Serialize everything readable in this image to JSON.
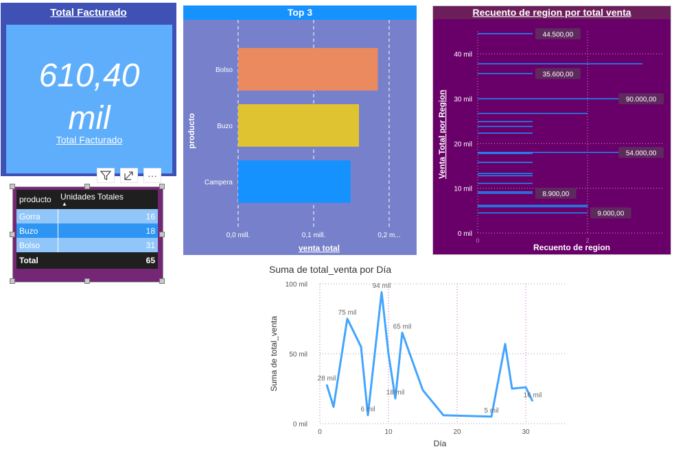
{
  "kpi": {
    "title": "Total Facturado",
    "value_line1": "610,40",
    "value_line2": "mil",
    "subtitle": "Total Facturado"
  },
  "visual_header": {
    "icons": [
      "filter-icon",
      "focus-mode-icon",
      "more-options-icon"
    ],
    "more_glyph": "···"
  },
  "table": {
    "columns": [
      "producto",
      "Unidades Totales"
    ],
    "sort_indicator": "▲",
    "rows": [
      {
        "producto": "Gorra",
        "unidades": "16"
      },
      {
        "producto": "Buzo",
        "unidades": "18"
      },
      {
        "producto": "Bolso",
        "unidades": "31"
      }
    ],
    "total_label": "Total",
    "total_value": "65"
  },
  "chart_data": [
    {
      "type": "bar",
      "orientation": "horizontal",
      "title": "Top 3",
      "xlabel": "venta total",
      "ylabel": "producto",
      "categories": [
        "Bolso",
        "Buzo",
        "Campera"
      ],
      "values": [
        185000,
        160000,
        149000
      ],
      "colors": [
        "#eb895f",
        "#e0c331",
        "#1692ff"
      ],
      "xlim": [
        0,
        200000
      ],
      "x_ticks": [
        0,
        100000,
        200000
      ],
      "x_tick_labels": [
        "0,0 mill.",
        "0,1 mill.",
        "0,2 m..."
      ],
      "grid": "dashed-vertical"
    },
    {
      "type": "bar",
      "orientation": "horizontal",
      "title": "Recuento de region por total venta",
      "xlabel": "Recuento de region",
      "ylabel": "Venta Total por Region",
      "xlim": [
        0,
        3
      ],
      "x_ticks": [
        0,
        2
      ],
      "ylim": [
        0,
        45000
      ],
      "y_ticks": [
        0,
        10000,
        20000,
        30000,
        40000
      ],
      "y_tick_labels": [
        "0 mil",
        "10 mil",
        "20 mil",
        "30 mil",
        "40 mil"
      ],
      "points": [
        {
          "y": 44500,
          "x": 1
        },
        {
          "y": 37800,
          "x": 3
        },
        {
          "y": 35600,
          "x": 1
        },
        {
          "y": 30000,
          "x": 3
        },
        {
          "y": 26700,
          "x": 2
        },
        {
          "y": 24900,
          "x": 1
        },
        {
          "y": 23800,
          "x": 1
        },
        {
          "y": 22300,
          "x": 1
        },
        {
          "y": 18000,
          "x": 3
        },
        {
          "y": 17800,
          "x": 1
        },
        {
          "y": 15800,
          "x": 1
        },
        {
          "y": 13300,
          "x": 1
        },
        {
          "y": 12800,
          "x": 1
        },
        {
          "y": 11100,
          "x": 1
        },
        {
          "y": 9200,
          "x": 1
        },
        {
          "y": 8900,
          "x": 1
        },
        {
          "y": 6200,
          "x": 2
        },
        {
          "y": 5900,
          "x": 2
        },
        {
          "y": 4500,
          "x": 2
        }
      ],
      "labels": [
        {
          "text": "44.500,00",
          "y": 44500,
          "x": 1
        },
        {
          "text": "35.600,00",
          "y": 35600,
          "x": 1
        },
        {
          "text": "90.000,00",
          "y": 30000,
          "x": 3
        },
        {
          "text": "54.000,00",
          "y": 18000,
          "x": 3
        },
        {
          "text": "8.900,00",
          "y": 8900,
          "x": 1
        },
        {
          "text": "9.000,00",
          "y": 4500,
          "x": 2
        }
      ],
      "bar_color": "#1692ff",
      "label_bg": "#5e2a5e"
    },
    {
      "type": "line",
      "title": "Suma de total_venta por Día",
      "xlabel": "Día",
      "ylabel": "Suma de total_venta",
      "xlim": [
        0,
        36
      ],
      "x_ticks": [
        0,
        10,
        20,
        30
      ],
      "ylim": [
        0,
        100000
      ],
      "y_ticks": [
        0,
        50000,
        100000
      ],
      "y_tick_labels": [
        "0 mil",
        "50 mil",
        "100 mil"
      ],
      "series": [
        {
          "color": "#41a4ff",
          "x": [
            1,
            2,
            4,
            6,
            7,
            9,
            10,
            11,
            12,
            15,
            18,
            25,
            27,
            28,
            30,
            31
          ],
          "y": [
            28000,
            12000,
            75000,
            55000,
            6000,
            94000,
            50000,
            18000,
            65000,
            24000,
            6000,
            5000,
            57000,
            25000,
            26000,
            16000
          ]
        }
      ],
      "data_labels": [
        {
          "x": 1,
          "y": 28000,
          "text": "28 mil"
        },
        {
          "x": 4,
          "y": 75000,
          "text": "75 mil"
        },
        {
          "x": 7,
          "y": 6000,
          "text": "6 mil"
        },
        {
          "x": 9,
          "y": 94000,
          "text": "94 mil"
        },
        {
          "x": 11,
          "y": 18000,
          "text": "18 mil"
        },
        {
          "x": 12,
          "y": 65000,
          "text": "65 mil"
        },
        {
          "x": 25,
          "y": 5000,
          "text": "5 mil"
        },
        {
          "x": 31,
          "y": 16000,
          "text": "16 mil"
        }
      ]
    }
  ]
}
